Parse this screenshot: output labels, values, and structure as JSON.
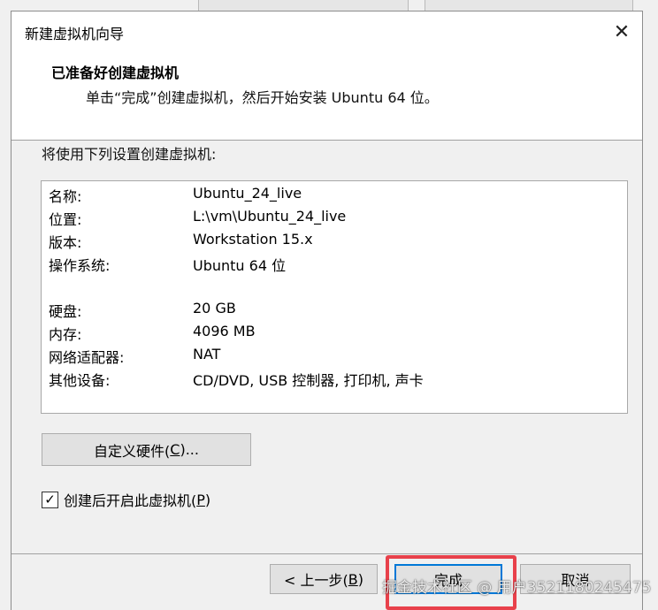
{
  "window": {
    "title": "新建虚拟机向导",
    "close_glyph": "✕"
  },
  "header": {
    "title": "已准备好创建虚拟机",
    "subtitle": "单击“完成”创建虚拟机，然后开始安装 Ubuntu 64 位。"
  },
  "main": {
    "intro": "将使用下列设置创建虚拟机:",
    "summary": [
      {
        "key": "名称:",
        "value": "Ubuntu_24_live"
      },
      {
        "key": "位置:",
        "value": "L:\\vm\\Ubuntu_24_live"
      },
      {
        "key": "版本:",
        "value": "Workstation 15.x"
      },
      {
        "key": "操作系统:",
        "value": "Ubuntu 64 位"
      },
      {
        "key": "硬盘:",
        "value": "20 GB"
      },
      {
        "key": "内存:",
        "value": "4096 MB"
      },
      {
        "key": "网络适配器:",
        "value": "NAT"
      },
      {
        "key": "其他设备:",
        "value": "CD/DVD, USB 控制器, 打印机, 声卡"
      }
    ],
    "customize_hardware": {
      "label": "自定义硬件(",
      "mnemonic": "C",
      "suffix": ")..."
    },
    "power_on_after": {
      "label": "创建后开启此虚拟机(",
      "mnemonic": "P",
      "suffix": ")",
      "checked": true,
      "check_glyph": "✓"
    }
  },
  "footer": {
    "back": {
      "label": "< 上一步(",
      "mnemonic": "B",
      "suffix": ")"
    },
    "finish": {
      "label": "完成"
    },
    "cancel": {
      "label": "取消"
    }
  },
  "overlay": {
    "highlight_color": "#e8414b",
    "watermark": "掘金技术社区 @ 用户3521180245475"
  }
}
